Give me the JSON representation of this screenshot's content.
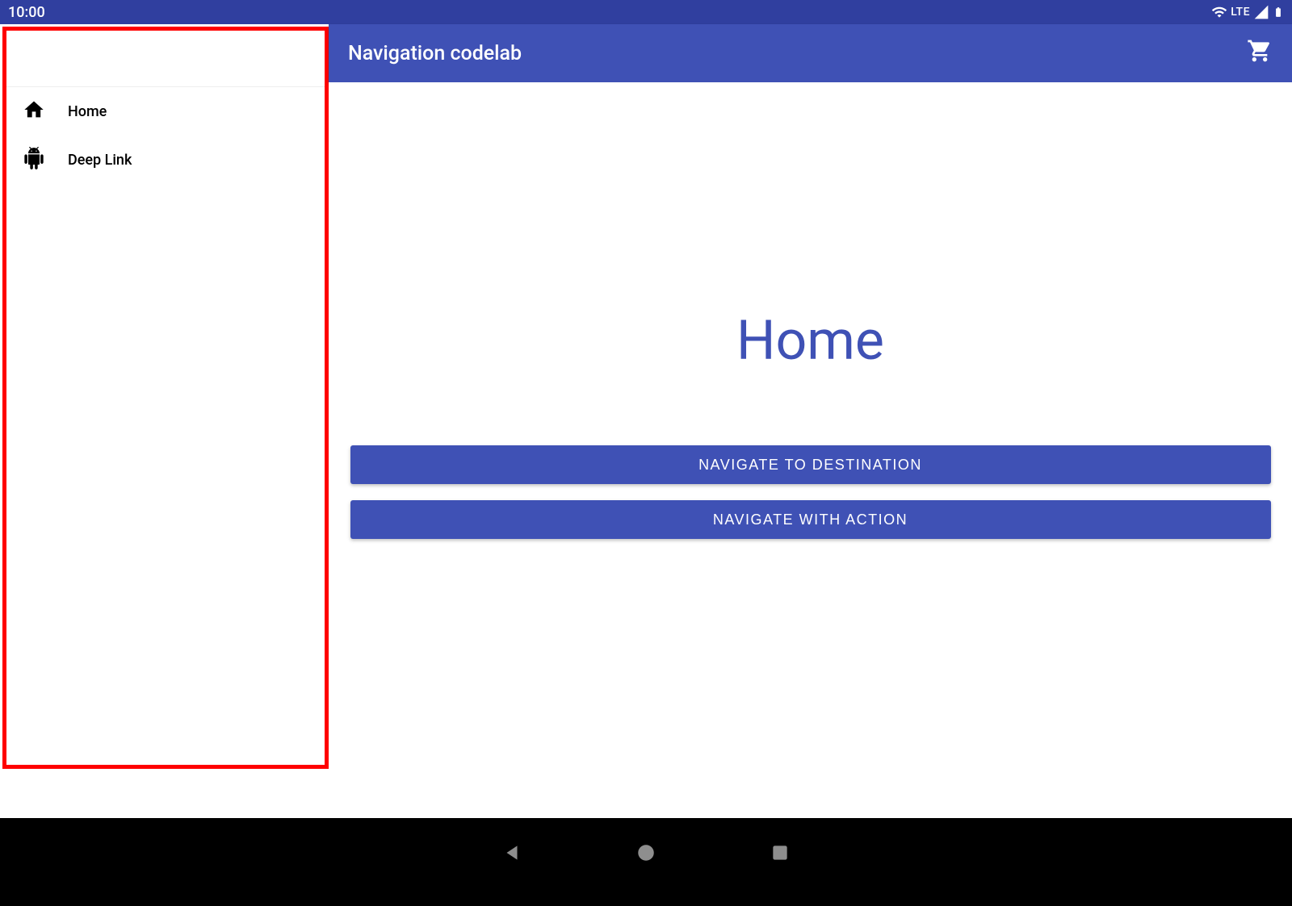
{
  "statusbar": {
    "time": "10:00",
    "network_label": "LTE"
  },
  "drawer": {
    "items": [
      {
        "icon": "home-icon",
        "label": "Home"
      },
      {
        "icon": "android-icon",
        "label": "Deep Link"
      }
    ]
  },
  "appbar": {
    "title": "Navigation codelab",
    "action_icon": "cart-icon"
  },
  "main": {
    "heading": "Home",
    "buttons": [
      {
        "label": "NAVIGATE TO DESTINATION"
      },
      {
        "label": "NAVIGATE WITH ACTION"
      }
    ]
  },
  "sysnav": {
    "back": "back-triangle",
    "home": "home-circle",
    "recent": "recent-square"
  },
  "colors": {
    "primary": "#3f51b5",
    "primary_dark": "#303f9f",
    "highlight": "#ff0000"
  }
}
